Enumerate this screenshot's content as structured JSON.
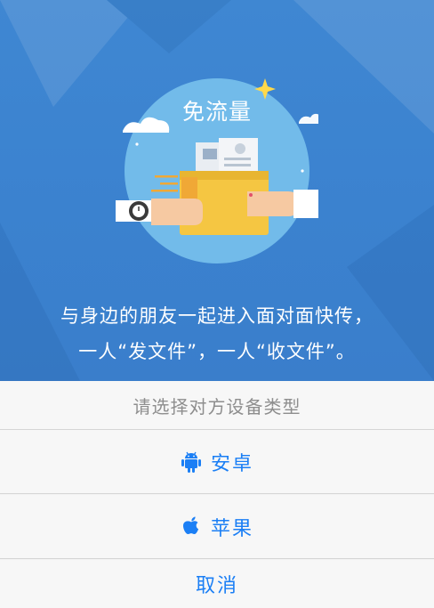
{
  "hero": {
    "badge": "免流量",
    "slogan_line1": "与身边的朋友一起进入面对面快传，",
    "slogan_line2": "一人“发文件”，一人“收文件”。"
  },
  "sheet": {
    "title": "请选择对方设备类型",
    "options": [
      {
        "icon": "android-icon",
        "label": "安卓"
      },
      {
        "icon": "apple-icon",
        "label": "苹果"
      }
    ],
    "cancel": "取消"
  },
  "colors": {
    "hero_bg": "#3f87d2",
    "accent": "#1b7ff5",
    "circle": "#72bbea",
    "folder": "#f5c642"
  }
}
